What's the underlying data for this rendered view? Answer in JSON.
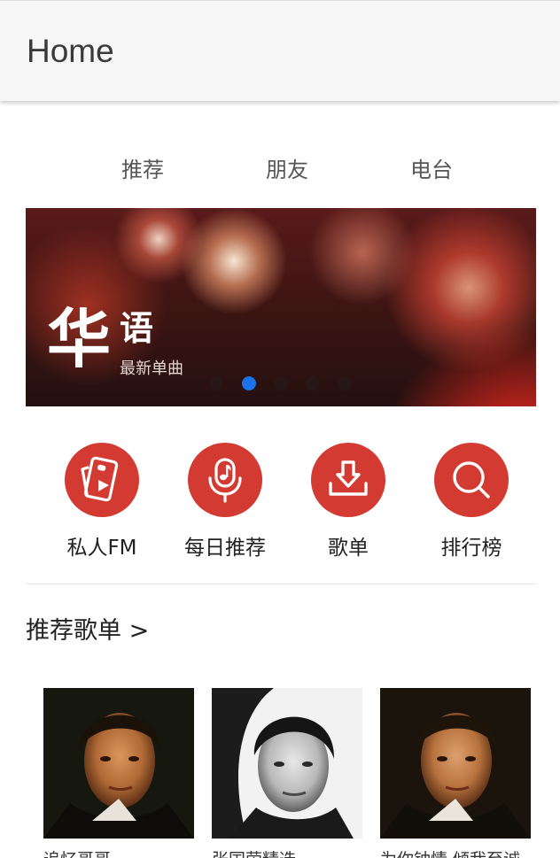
{
  "appbar": {
    "title": "Home"
  },
  "tabs": [
    {
      "label": "推荐"
    },
    {
      "label": "朋友"
    },
    {
      "label": "电台"
    }
  ],
  "banner": {
    "title_big": "华",
    "title_small": "语",
    "subtitle": "最新单曲",
    "page_count": 5,
    "active_index": 1,
    "accent_color": "#1a73e8"
  },
  "shortcuts": [
    {
      "label": "私人FM",
      "icon": "radio-card-icon"
    },
    {
      "label": "每日推荐",
      "icon": "microphone-note-icon"
    },
    {
      "label": "歌单",
      "icon": "download-tray-icon"
    },
    {
      "label": "排行榜",
      "icon": "search-icon"
    }
  ],
  "shortcut_color": "#d33a31",
  "section": {
    "title": "推荐歌单 >"
  },
  "playlists": [
    {
      "title": "追忆哥哥",
      "cover": "portrait-color"
    },
    {
      "title": "张国荣精选",
      "cover": "portrait-bw"
    },
    {
      "title": "为你钟情 倾我至诚",
      "cover": "portrait-color"
    }
  ]
}
